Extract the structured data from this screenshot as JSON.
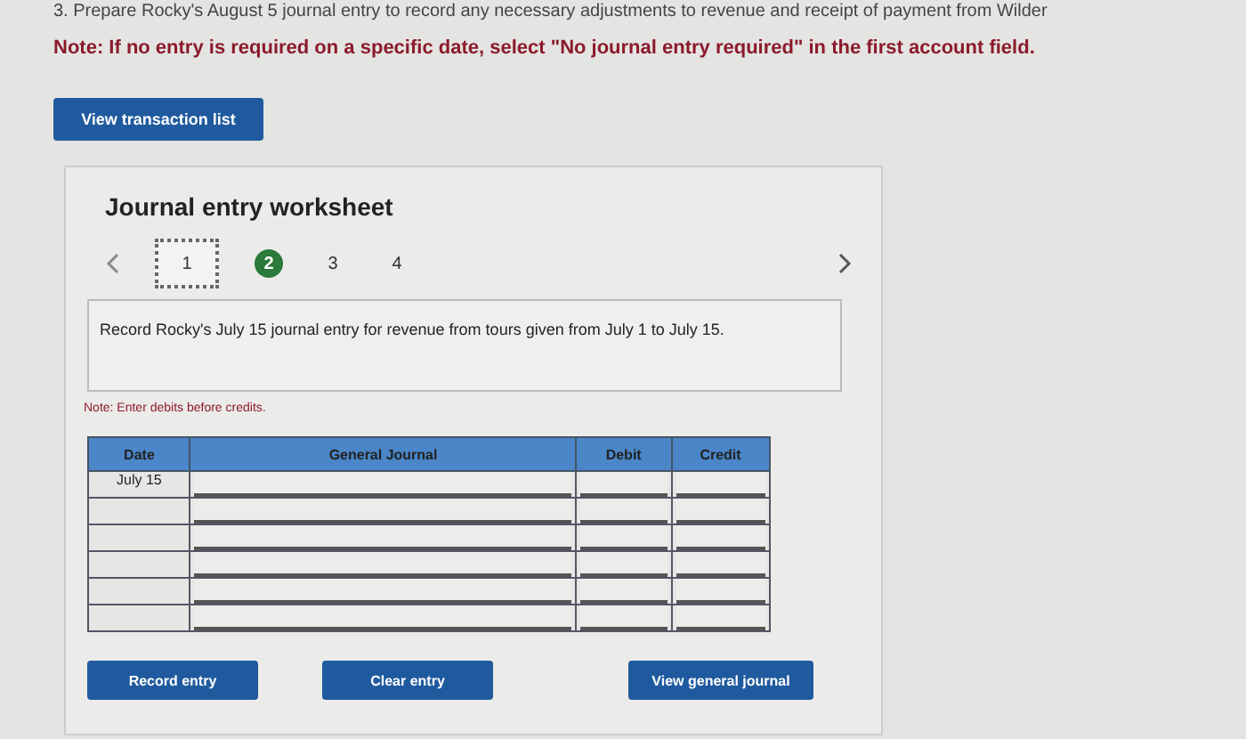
{
  "question": "3. Prepare Rocky's August 5 journal entry to record any necessary adjustments to revenue and receipt of payment from Wilder",
  "note": "Note: If no entry is required on a specific date, select \"No journal entry required\" in the first account field.",
  "view_transactions_button": "View transaction list",
  "worksheet": {
    "title": "Journal entry worksheet",
    "steps": [
      {
        "label": "1",
        "selected": true,
        "completed": false
      },
      {
        "label": "2",
        "selected": false,
        "completed": true
      },
      {
        "label": "3",
        "selected": false,
        "completed": false
      },
      {
        "label": "4",
        "selected": false,
        "completed": false
      }
    ],
    "instruction": "Record Rocky's July 15 journal entry for revenue from tours given from July 1 to July 15.",
    "note": "Note: Enter debits before credits.",
    "table": {
      "columns": [
        "Date",
        "General Journal",
        "Debit",
        "Credit"
      ],
      "rows": [
        {
          "date": "July 15"
        },
        {
          "date": ""
        },
        {
          "date": ""
        },
        {
          "date": ""
        },
        {
          "date": ""
        },
        {
          "date": ""
        }
      ]
    },
    "buttons": [
      "Record entry",
      "Clear entry",
      "View general journal"
    ]
  }
}
